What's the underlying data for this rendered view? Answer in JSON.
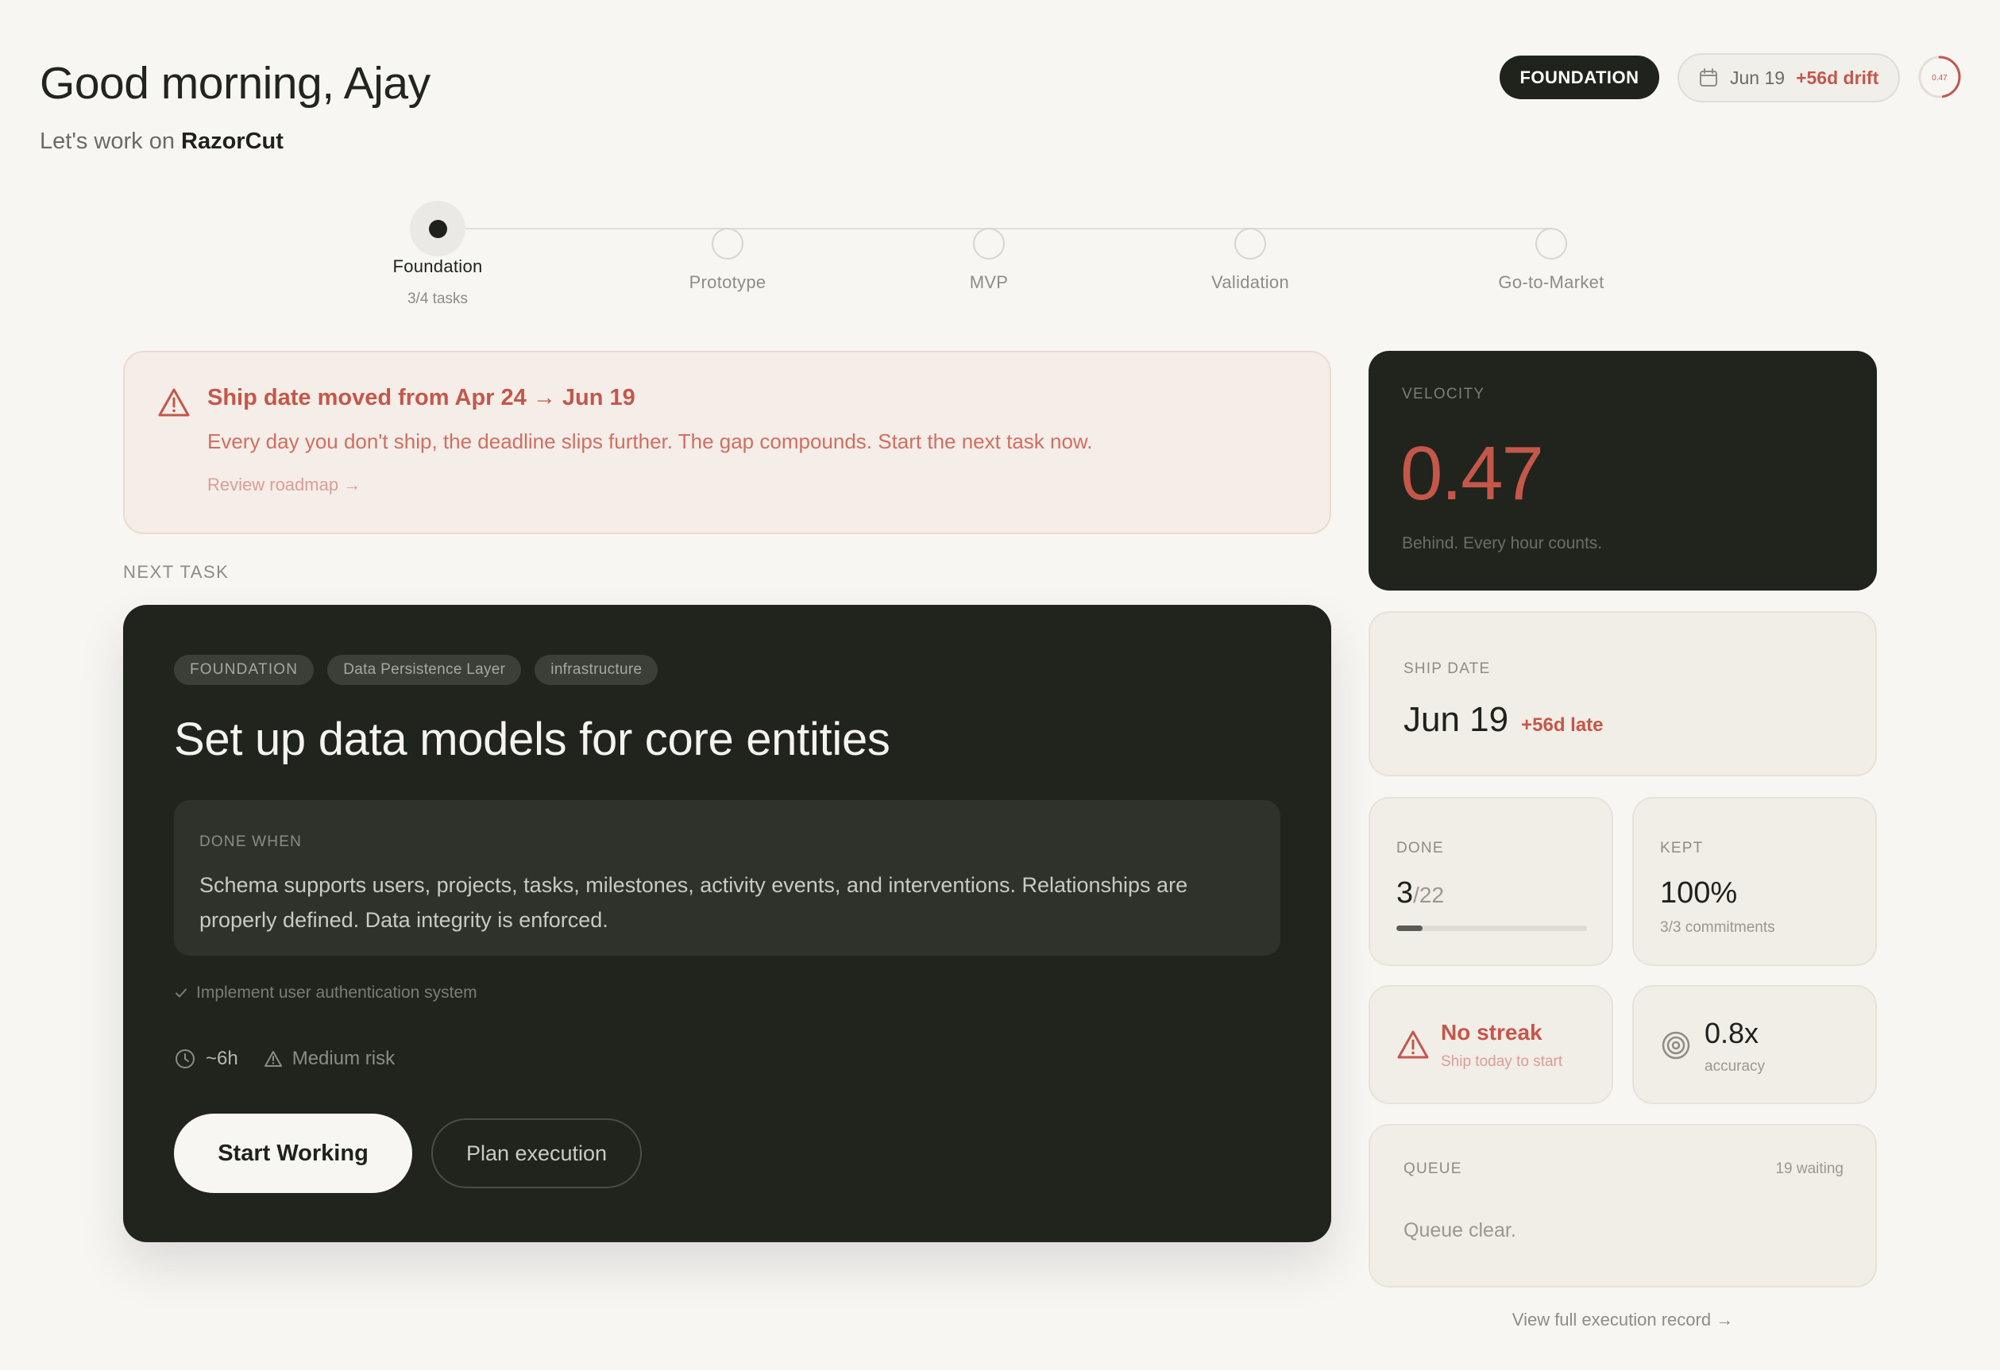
{
  "header": {
    "greeting": "Good morning, Ajay",
    "sub_prefix": "Let's work on",
    "project": "RazorCut",
    "phase_pill": "FOUNDATION",
    "date": "Jun 19",
    "drift": "+56d drift",
    "score": "0.47"
  },
  "stepper": {
    "steps": [
      {
        "label": "Foundation",
        "sub": "3/4 tasks"
      },
      {
        "label": "Prototype"
      },
      {
        "label": "MVP"
      },
      {
        "label": "Validation"
      },
      {
        "label": "Go-to-Market"
      }
    ]
  },
  "alert": {
    "title": "Ship date moved from Apr 24 → Jun 19",
    "body": "Every day you don't ship, the deadline slips further. The gap compounds. Start the next task now.",
    "link": "Review roadmap →"
  },
  "next_task": {
    "section_label": "NEXT TASK",
    "tags": [
      "FOUNDATION",
      "Data Persistence Layer",
      "infrastructure"
    ],
    "title": "Set up data models for core entities",
    "done_when_label": "DONE WHEN",
    "done_when_text": "Schema supports users, projects, tasks, milestones, activity events, and interventions. Relationships are properly defined. Data integrity is enforced.",
    "dependency": "Implement user authentication system",
    "estimate": "~6h",
    "risk": "Medium risk",
    "start_label": "Start Working",
    "plan_label": "Plan execution"
  },
  "velocity": {
    "label": "VELOCITY",
    "value": "0.47",
    "caption": "Behind. Every hour counts."
  },
  "ship_date": {
    "label": "SHIP DATE",
    "value": "Jun 19",
    "late": "+56d late"
  },
  "done": {
    "label": "DONE",
    "value": "3",
    "total": "/22",
    "progress": 0.136
  },
  "kept": {
    "label": "KEPT",
    "value": "100%",
    "sub": "3/3 commitments"
  },
  "streak": {
    "title": "No streak",
    "sub": "Ship today to start"
  },
  "accuracy": {
    "value": "0.8x",
    "sub": "accuracy"
  },
  "queue": {
    "label": "QUEUE",
    "count": "19 waiting",
    "empty": "Queue clear."
  },
  "footer_link": "View full execution record →",
  "colors": {
    "accent": "#c4574a",
    "dark": "#20241d",
    "background": "#f7f6f3"
  }
}
